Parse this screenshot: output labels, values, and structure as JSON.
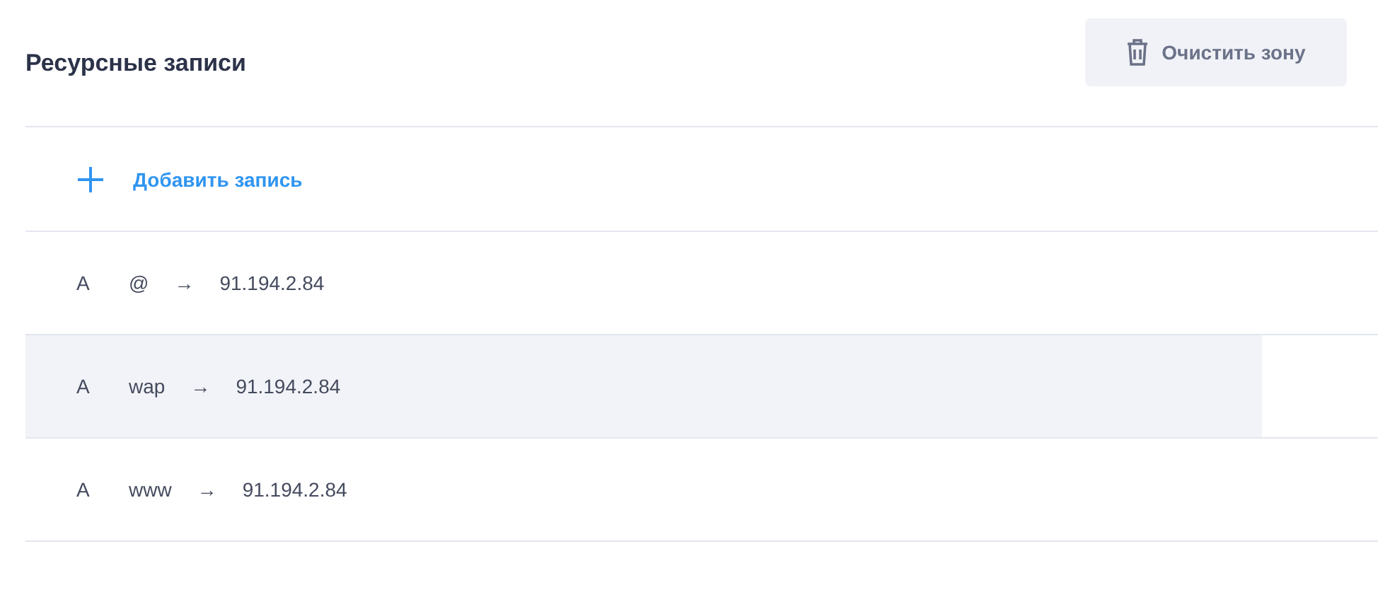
{
  "header": {
    "title": "Ресурсные записи",
    "clear_button": "Очистить зону"
  },
  "add_record": {
    "label": "Добавить запись"
  },
  "records": [
    {
      "type": "A",
      "name": "@",
      "arrow": "→",
      "value": "91.194.2.84",
      "highlighted": false
    },
    {
      "type": "A",
      "name": "wap",
      "arrow": "→",
      "value": "91.194.2.84",
      "highlighted": true
    },
    {
      "type": "A",
      "name": "www",
      "arrow": "→",
      "value": "91.194.2.84",
      "highlighted": false
    }
  ]
}
